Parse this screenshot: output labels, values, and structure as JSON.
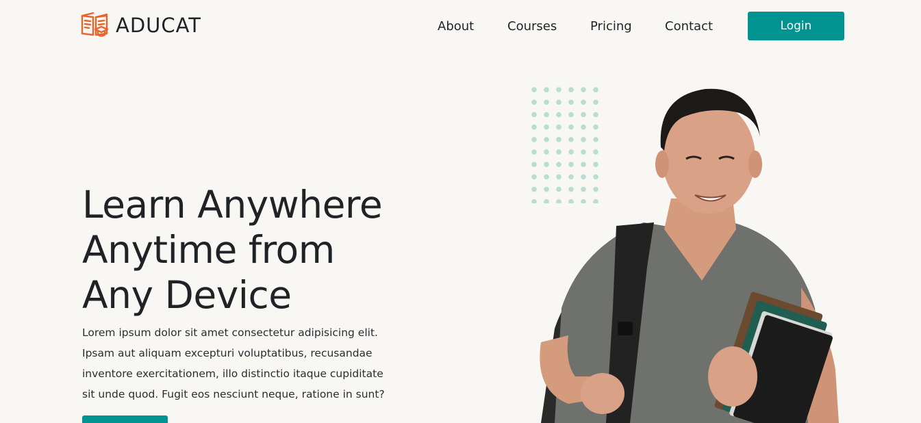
{
  "brand": {
    "name": "ADUCAT",
    "icon": "book-graduation-cap-icon",
    "icon_color": "#e8662c"
  },
  "nav": {
    "items": [
      {
        "label": "About"
      },
      {
        "label": "Courses"
      },
      {
        "label": "Pricing"
      },
      {
        "label": "Contact"
      }
    ],
    "login_label": "Login"
  },
  "hero": {
    "title_lines": [
      "Learn Anywhere",
      "Anytime from",
      "Any Device"
    ],
    "description_lines": [
      "Lorem ipsum dolor sit amet consectetur adipisicing elit.",
      "Ipsam aut aliquam excepturi voluptatibus, recusandae",
      "inventore exercitationem, illo distinctio itaque cupiditate",
      "sit unde quod. Fugit eos nesciunt neque, ratione in sunt?"
    ],
    "cta_label": ""
  },
  "colors": {
    "accent": "#009390",
    "background": "#f8f7f4",
    "text": "#1f2326",
    "dots": "#b9dcd6"
  }
}
